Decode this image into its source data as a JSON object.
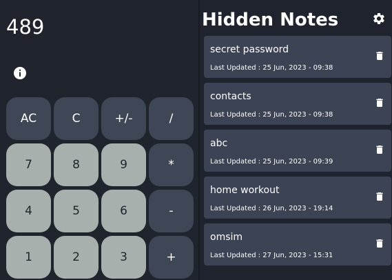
{
  "calculator": {
    "display": "489",
    "info_icon": "info-icon",
    "keys": [
      {
        "label": "AC",
        "tone": "dark"
      },
      {
        "label": "C",
        "tone": "dark"
      },
      {
        "label": "+/-",
        "tone": "dark"
      },
      {
        "label": "/",
        "tone": "dark"
      },
      {
        "label": "7",
        "tone": "light"
      },
      {
        "label": "8",
        "tone": "light"
      },
      {
        "label": "9",
        "tone": "light"
      },
      {
        "label": "*",
        "tone": "dark"
      },
      {
        "label": "4",
        "tone": "light"
      },
      {
        "label": "5",
        "tone": "light"
      },
      {
        "label": "6",
        "tone": "light"
      },
      {
        "label": "-",
        "tone": "dark"
      },
      {
        "label": "1",
        "tone": "light"
      },
      {
        "label": "2",
        "tone": "light"
      },
      {
        "label": "3",
        "tone": "light"
      },
      {
        "label": "+",
        "tone": "dark"
      }
    ]
  },
  "notes": {
    "title": "Hidden Notes",
    "settings_icon": "gear-icon",
    "delete_icon": "trash-icon",
    "items": [
      {
        "title": "secret password",
        "updated": "Last Updated : 25 Jun, 2023 - 09:38"
      },
      {
        "title": "contacts",
        "updated": "Last Updated : 25 Jun, 2023 - 09:38"
      },
      {
        "title": "abc",
        "updated": "Last Updated : 25 Jun, 2023 - 09:39"
      },
      {
        "title": "home workout",
        "updated": "Last Updated : 26 Jun, 2023 - 19:14"
      },
      {
        "title": "omsim",
        "updated": "Last Updated : 27 Jun, 2023 - 15:31"
      }
    ]
  },
  "colors": {
    "background": "#1e232d",
    "card": "#3c4355",
    "key_dark": "#3f4656",
    "key_light": "#a8b0ad",
    "text": "#ffffff"
  }
}
